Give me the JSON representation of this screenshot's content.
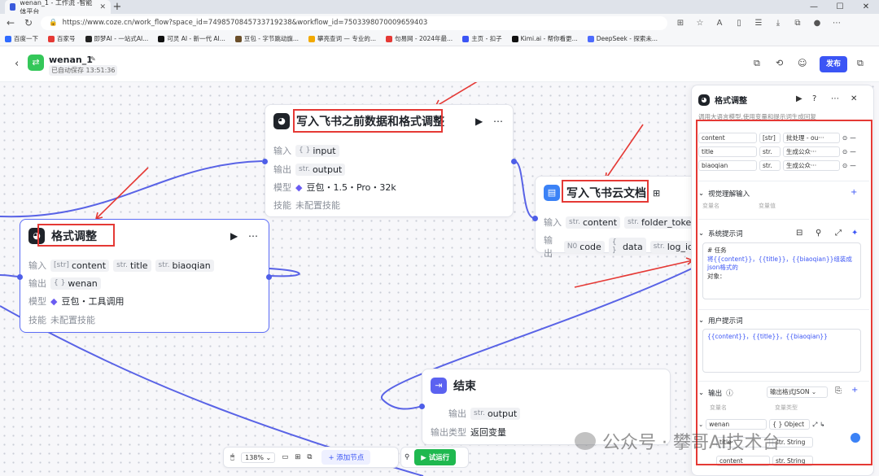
{
  "browser": {
    "tab_title": "wenan_1 - 工作流 -智能体平台",
    "url": "https://www.coze.cn/work_flow?space_id=7498570845733719238&workflow_id=7503398070009659403",
    "bookmarks": [
      "百度一下",
      "百家号",
      "即梦AI - 一站式AI...",
      "可灵 AI - 新一代 AI...",
      "豆包 - 字节跳动旗...",
      "攀亮查词 — 专业的...",
      "句易网 - 2024年最...",
      "主页 - 扣子",
      "Kimi.ai - 帮你看更...",
      "DeepSeek - 探索未..."
    ]
  },
  "header": {
    "app_name": "wenan_1",
    "saved_status": "已自动保存 13:51:36",
    "publish_label": "发布"
  },
  "nodes": {
    "feishu_prev": {
      "title": "写入飞书之前数据和格式调整",
      "input_label": "输入",
      "input_chip": "input",
      "input_type": "{ }",
      "output_label": "输出",
      "output_chip": "output",
      "output_type": "str.",
      "model_label": "模型",
      "model_value": "豆包・1.5・Pro・32k",
      "skill_label": "技能",
      "skill_value": "未配置技能"
    },
    "feishu_doc": {
      "title": "写入飞书云文档",
      "input_label": "输入",
      "inputs": [
        {
          "type": "str.",
          "name": "content"
        },
        {
          "type": "str.",
          "name": "folder_token"
        }
      ],
      "output_label": "输出",
      "outputs": [
        {
          "type": "N0",
          "name": "code"
        },
        {
          "type": "{ }",
          "name": "data"
        },
        {
          "type": "str.",
          "name": "log_id"
        }
      ]
    },
    "format": {
      "title": "格式调整",
      "input_label": "输入",
      "inputs": [
        {
          "type": "[str]",
          "name": "content"
        },
        {
          "type": "str.",
          "name": "title"
        },
        {
          "type": "str.",
          "name": "biaoqian"
        }
      ],
      "output_label": "输出",
      "output_chip": "wenan",
      "output_type": "{ }",
      "model_label": "模型",
      "model_value": "豆包・工具调用",
      "skill_label": "技能",
      "skill_value": "未配置技能"
    },
    "end": {
      "title": "结束",
      "output_label": "输出",
      "output_chip": "output",
      "output_type": "str.",
      "output_type_label": "输出类型",
      "output_type_value": "返回变量"
    }
  },
  "panel": {
    "title": "格式调整",
    "description": "调用大语言模型,使用变量和提示词生成回复",
    "vars": [
      {
        "name": "content",
        "type": "[str]",
        "ref": "批处理 - ou···"
      },
      {
        "name": "title",
        "type": "str.",
        "ref": "生成公众···"
      },
      {
        "name": "biaoqian",
        "type": "str.",
        "ref": "生成公众···"
      }
    ],
    "vision_title": "视觉理解输入",
    "vision_var_name": "变量名",
    "vision_var_value": "变量值",
    "system_prompt_title": "系统提示词",
    "system_prompt_line1": "# 任务",
    "system_prompt_line2": "将{{content}}，{{title}}，{{biaoqian}}组装成json格式的",
    "system_prompt_line3": "对象：",
    "user_prompt_title": "用户提示词",
    "user_prompt": "{{content}}，{{title}}，{{biaoqian}}",
    "output_title": "输出",
    "output_format": "输出格式JSON",
    "out_col_name": "变量名",
    "out_col_type": "变量类型",
    "out_rows": [
      {
        "name": "wenan",
        "type": "{ } Object"
      },
      {
        "name": "title",
        "type": "str. String"
      },
      {
        "name": "content",
        "type": "str. String"
      }
    ]
  },
  "toolbar": {
    "zoom": "138%",
    "add_node": "+ 添加节点",
    "run": "试运行"
  },
  "watermark": "公众号 · 攀哥AI技术台"
}
